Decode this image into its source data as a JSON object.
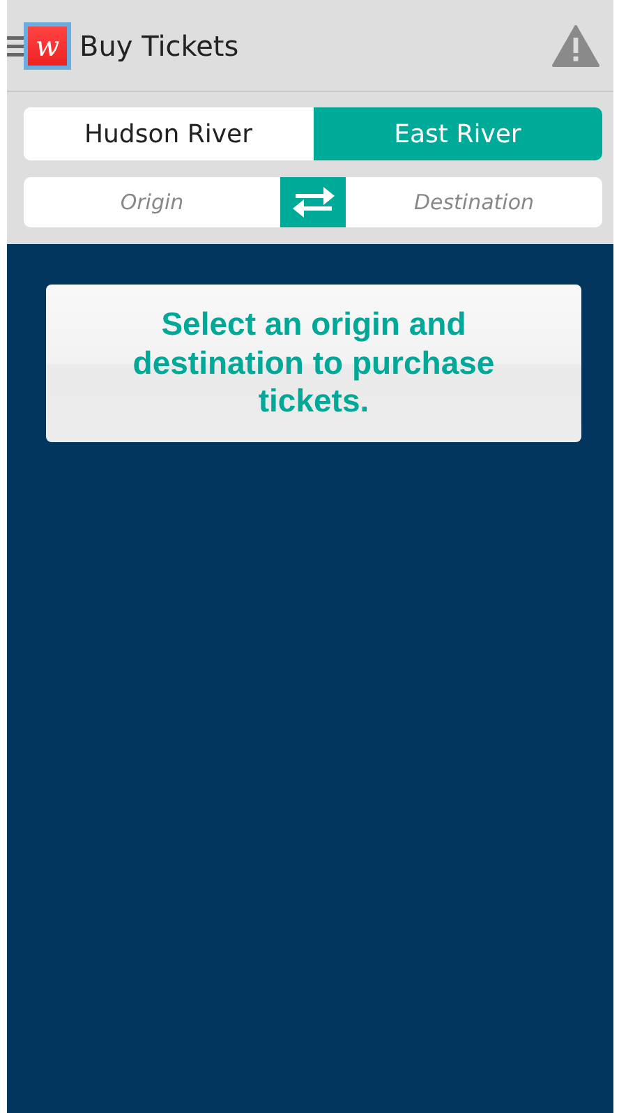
{
  "app_bar": {
    "logo_letter": "w",
    "title": "Buy Tickets"
  },
  "tabs": [
    {
      "label": "Hudson River",
      "selected": false
    },
    {
      "label": "East River",
      "selected": true
    }
  ],
  "route": {
    "origin_placeholder": "Origin",
    "destination_placeholder": "Destination"
  },
  "message": "Select an origin and destination to purchase tickets."
}
